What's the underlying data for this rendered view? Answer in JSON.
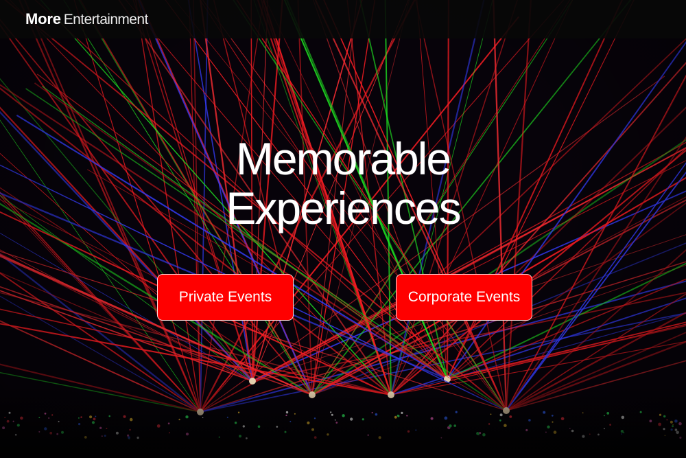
{
  "header": {
    "brand_bold": "More",
    "brand_light": "Entertainment"
  },
  "hero": {
    "line1": "Memorable",
    "line2": "Experiences"
  },
  "buttons": {
    "private_label": "Private Events",
    "corporate_label": "Corporate Events"
  },
  "colors": {
    "button_bg": "#ff0000",
    "topbar_bg": "#080808"
  }
}
